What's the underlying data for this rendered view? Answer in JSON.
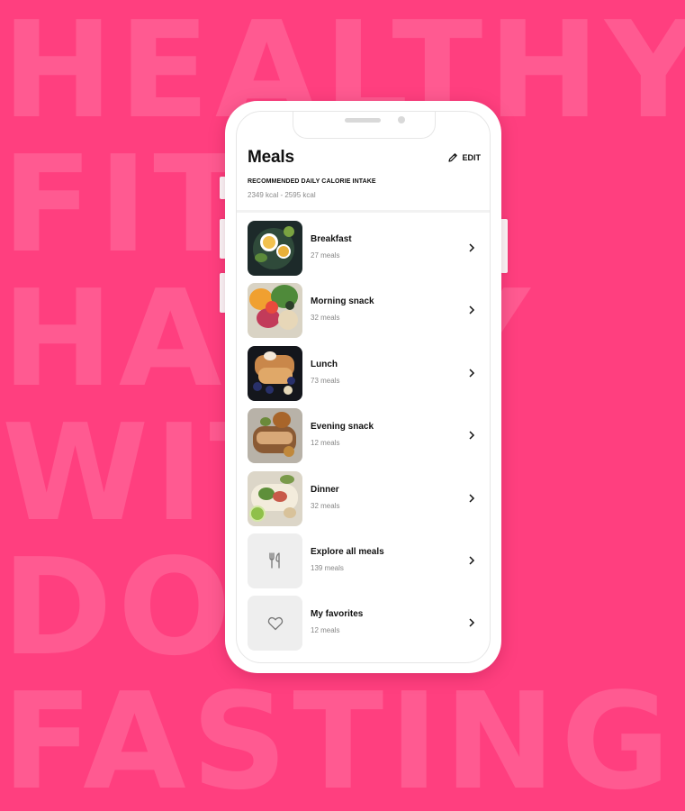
{
  "background_words": [
    "HEALTHY",
    "FIT",
    "HAPPY",
    "WITH",
    "DO",
    "FASTING"
  ],
  "colors": {
    "background": "#ff3f7f",
    "card": "#ffffff",
    "text": "#111111",
    "muted": "#888888"
  },
  "header": {
    "title": "Meals",
    "edit_label": "EDIT",
    "edit_icon": "pencil-icon",
    "subtitle": "RECOMMENDED DAILY CALORIE INTAKE",
    "calorie_range": "2349 kcal - 2595 kcal"
  },
  "meals": [
    {
      "name": "Breakfast",
      "count": "27 meals",
      "thumb": "breakfast-photo"
    },
    {
      "name": "Morning snack",
      "count": "32 meals",
      "thumb": "morning-snack-photo"
    },
    {
      "name": "Lunch",
      "count": "73 meals",
      "thumb": "lunch-photo"
    },
    {
      "name": "Evening snack",
      "count": "12 meals",
      "thumb": "evening-snack-photo"
    },
    {
      "name": "Dinner",
      "count": "32 meals",
      "thumb": "dinner-photo"
    },
    {
      "name": "Explore all meals",
      "count": "139 meals",
      "thumb": "fork-knife-icon"
    },
    {
      "name": "My favorites",
      "count": "12 meals",
      "thumb": "heart-icon"
    }
  ]
}
